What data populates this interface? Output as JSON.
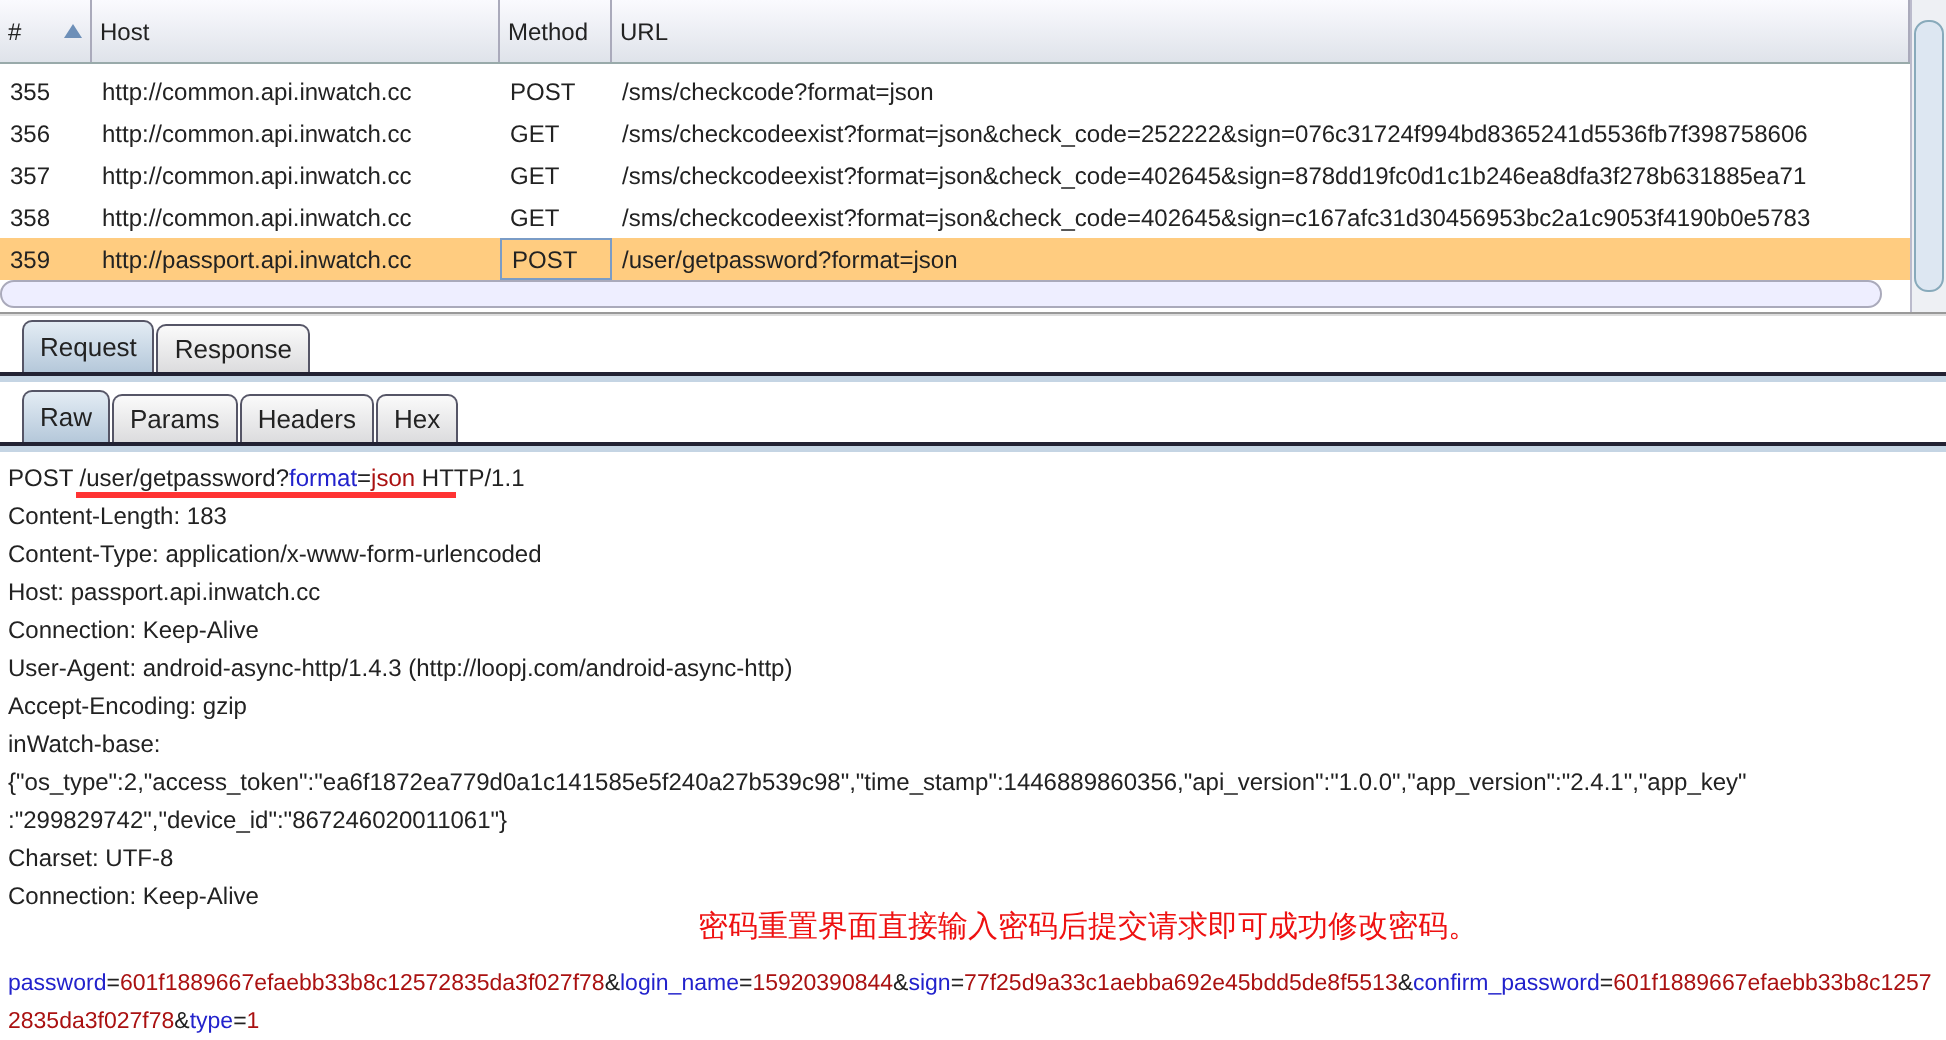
{
  "table": {
    "columns": [
      {
        "label": "#",
        "sorted": true
      },
      {
        "label": "Host",
        "sorted": false
      },
      {
        "label": "Method",
        "sorted": false
      },
      {
        "label": "URL",
        "sorted": false
      }
    ],
    "rows": [
      {
        "cells": [
          "355",
          "http://common.api.inwatch.cc",
          "POST",
          "/sms/checkcode?format=json"
        ],
        "selected": false
      },
      {
        "cells": [
          "356",
          "http://common.api.inwatch.cc",
          "GET",
          "/sms/checkcodeexist?format=json&check_code=252222&sign=076c31724f994bd8365241d5536fb7f398758606"
        ],
        "selected": false
      },
      {
        "cells": [
          "357",
          "http://common.api.inwatch.cc",
          "GET",
          "/sms/checkcodeexist?format=json&check_code=402645&sign=878dd19fc0d1c1b246ea8dfa3f278b631885ea71"
        ],
        "selected": false
      },
      {
        "cells": [
          "358",
          "http://common.api.inwatch.cc",
          "GET",
          "/sms/checkcodeexist?format=json&check_code=402645&sign=c167afc31d30456953bc2a1c9053f4190b0e5783"
        ],
        "selected": false
      },
      {
        "cells": [
          "359",
          "http://passport.api.inwatch.cc",
          "POST",
          "/user/getpassword?format=json"
        ],
        "selected": true
      }
    ]
  },
  "tabs": [
    {
      "label": "Request",
      "selected": true
    },
    {
      "label": "Response",
      "selected": false
    }
  ],
  "subtabs": [
    {
      "label": "Raw",
      "selected": true
    },
    {
      "label": "Params",
      "selected": false
    },
    {
      "label": "Headers",
      "selected": false
    },
    {
      "label": "Hex",
      "selected": false
    }
  ],
  "request": {
    "request_line": [
      {
        "kind": "plain",
        "text": "POST /user/getpassword?"
      },
      {
        "kind": "key",
        "text": "format"
      },
      {
        "kind": "plain",
        "text": "="
      },
      {
        "kind": "value",
        "text": "json"
      },
      {
        "kind": "plain",
        "text": " HTTP/1.1"
      }
    ],
    "headers": [
      "Content-Length: 183",
      "Content-Type: application/x-www-form-urlencoded",
      "Host: passport.api.inwatch.cc",
      "Connection: Keep-Alive",
      "User-Agent: android-async-http/1.4.3 (http://loopj.com/android-async-http)",
      "Accept-Encoding: gzip",
      "inWatch-base:",
      "{\"os_type\":2,\"access_token\":\"ea6f1872ea779d0a1c141585e5f240a27b539c98\",\"time_stamp\":1446889860356,\"api_version\":\"1.0.0\",\"app_version\":\"2.4.1\",\"app_key\"",
      ":\"299829742\",\"device_id\":\"867246020011061\"}",
      "Charset: UTF-8",
      "Connection: Keep-Alive"
    ],
    "body": [
      {
        "kind": "key",
        "text": "password"
      },
      {
        "kind": "plain",
        "text": "="
      },
      {
        "kind": "value",
        "text": "601f1889667efaebb33b8c12572835da3f027f78"
      },
      {
        "kind": "plain",
        "text": "&"
      },
      {
        "kind": "key",
        "text": "login_name"
      },
      {
        "kind": "plain",
        "text": "="
      },
      {
        "kind": "value",
        "text": "15920390844"
      },
      {
        "kind": "plain",
        "text": "&"
      },
      {
        "kind": "key",
        "text": "sign"
      },
      {
        "kind": "plain",
        "text": "="
      },
      {
        "kind": "value",
        "text": "77f25d9a33c1aebba692e45bdd5de8f5513"
      },
      {
        "kind": "plain",
        "text": "&"
      },
      {
        "kind": "key",
        "text": "confirm_password"
      },
      {
        "kind": "plain",
        "text": "="
      },
      {
        "kind": "value",
        "text": "601f1889667efaebb33b8c12572835da3f027f78"
      },
      {
        "kind": "plain",
        "text": "&"
      },
      {
        "kind": "key",
        "text": "type"
      },
      {
        "kind": "plain",
        "text": "="
      },
      {
        "kind": "value",
        "text": "1"
      }
    ]
  },
  "annotation": "密码重置界面直接输入密码后提交请求即可成功修改密码。"
}
